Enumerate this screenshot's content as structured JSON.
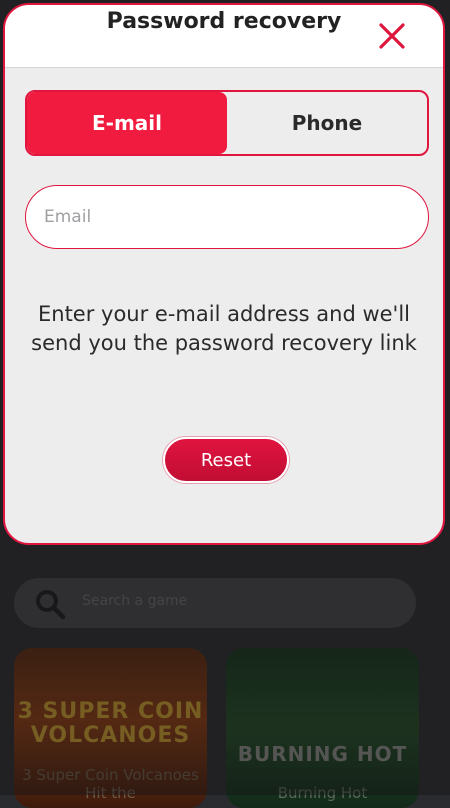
{
  "modal": {
    "title": "Password recovery",
    "tabs": [
      {
        "label": "E-mail",
        "active": true
      },
      {
        "label": "Phone",
        "active": false
      }
    ],
    "email_placeholder": "Email",
    "email_value": "",
    "hint": "Enter your e-mail address and we'll send you the password recovery link",
    "reset_label": "Reset"
  },
  "background": {
    "search_placeholder": "Search a game",
    "games": [
      {
        "logo": "3 SUPER COIN VOLCANOES",
        "title": "3 Super Coin Volcanoes Hit the"
      },
      {
        "logo": "BURNING HOT",
        "title": "Burning Hot"
      }
    ]
  },
  "colors": {
    "accent": "#e0163f",
    "modal_bg": "#ededee",
    "backdrop": "#2c2d30"
  },
  "icons": {
    "close": "close-icon",
    "search": "search-icon"
  }
}
